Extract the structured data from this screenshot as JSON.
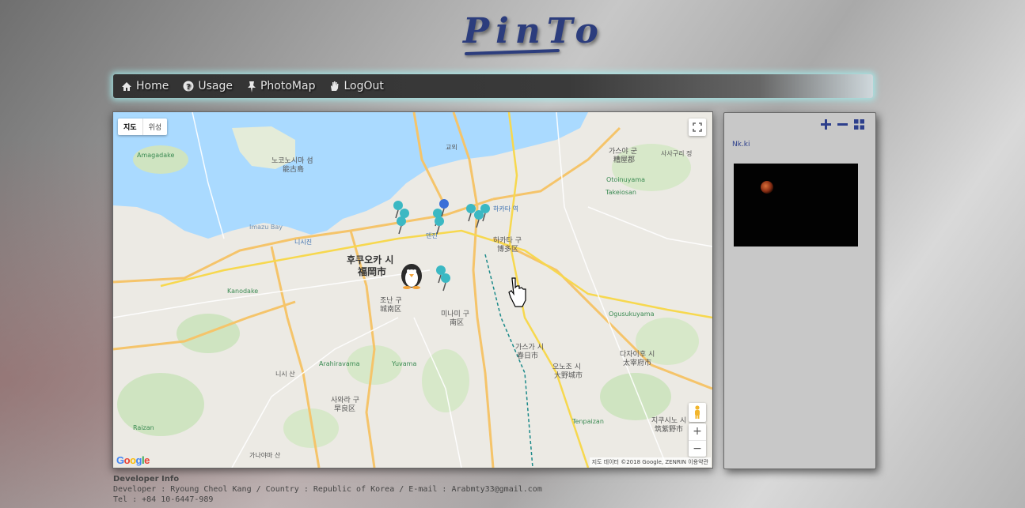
{
  "logo": {
    "text": "PinTo",
    "color": "#2c3d7d"
  },
  "nav": {
    "items": [
      {
        "label": "Home",
        "icon": "home-icon"
      },
      {
        "label": "Usage",
        "icon": "question-icon"
      },
      {
        "label": "PhotoMap",
        "icon": "pin-icon"
      },
      {
        "label": "LogOut",
        "icon": "hand-icon"
      }
    ],
    "glow_color": "#a0f0f0"
  },
  "map": {
    "type_controls": {
      "map": "지도",
      "satellite": "위성"
    },
    "google_logo": "Google",
    "attribution": "지도 데이터 ©2018 Google, ZENRIN   이용약관",
    "zoom_in": "+",
    "zoom_out": "−",
    "labels": {
      "city_ko": "후쿠오카 시",
      "city_ja": "福岡市",
      "hakata_ko": "하카타 구",
      "hakata_ja": "博多区",
      "jonan_ko": "조난 구",
      "jonan_ja": "城南区",
      "minami_ko": "미나미 구",
      "minami_ja": "南区",
      "kasuga_ko": "가스가 시",
      "kasuga_ja": "春日市",
      "sawara_ko": "사와라 구",
      "sawara_ja": "早良区",
      "onojo_ko": "오노조 시",
      "onojo_ja": "大野城市",
      "dazaifu_ko": "다자이후 시",
      "dazaifu_ja": "太宰府市",
      "chikushino_ko": "지쿠시노 시",
      "chikushino_ja": "筑紫野市",
      "kasuya_ko": "가스야 군",
      "kasuya_ja": "糟屋郡",
      "nokonoshima_ko": "노코노시마 섬",
      "nokonoshima_ja": "能古島",
      "imazu": "Imazu Bay",
      "amagadake": "Amagadake",
      "kanodake": "Kanodake",
      "arahiravama": "Arahiravama",
      "yuvama": "Yuvama",
      "raizan": "Raizan",
      "otoinuyama": "Otoinuyama",
      "takeiosan": "Takeiosan",
      "ogusukuyama": "Ogusukuyama",
      "tenpaizan": "Tenpaizan",
      "sasayama": "사사구리 정",
      "hakata_station": "하카타 역",
      "tenjin": "덴진",
      "nishijin": "니시진",
      "gyeonggi": "교외",
      "nishi": "니시 산",
      "kagamiyama": "가나야마 산"
    }
  },
  "side_panel": {
    "zoom_in": "+",
    "zoom_out": "−",
    "grid": "grid",
    "label": "Nk.ki",
    "photo_bg": "#020202"
  },
  "footer": {
    "title": "Developer Info",
    "line1": "Developer : Ryoung Cheol Kang / Country : Republic of Korea / E-mail : Arabmty33@gmail.com",
    "line2": "Tel : +84 10-6447-989"
  }
}
